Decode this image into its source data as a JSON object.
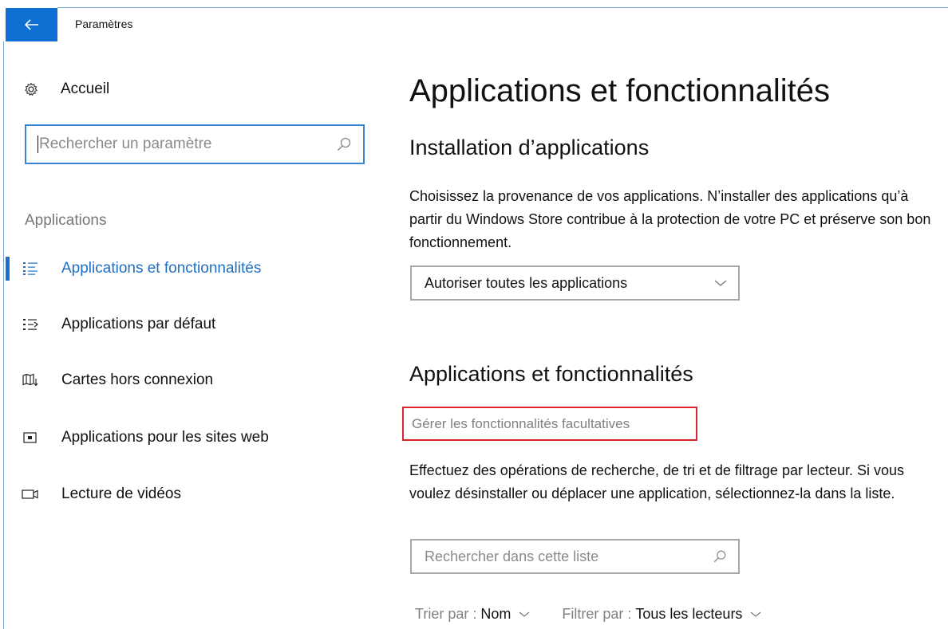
{
  "window": {
    "title": "Paramètres",
    "accent_color": "#0f6fd3"
  },
  "sidebar": {
    "home_label": "Accueil",
    "search_placeholder": "Rechercher un paramètre",
    "section_label": "Applications",
    "items": [
      {
        "label": "Applications et fonctionnalités",
        "icon": "apps-features-icon",
        "active": true
      },
      {
        "label": "Applications par défaut",
        "icon": "default-apps-icon",
        "active": false
      },
      {
        "label": "Cartes hors connexion",
        "icon": "offline-maps-icon",
        "active": false
      },
      {
        "label": "Applications pour les sites web",
        "icon": "apps-websites-icon",
        "active": false
      },
      {
        "label": "Lecture de vidéos",
        "icon": "video-playback-icon",
        "active": false
      }
    ]
  },
  "main": {
    "page_title": "Applications et fonctionnalités",
    "install_section": {
      "heading": "Installation d’applications",
      "description": "Choisissez la provenance de vos applications. N’installer des applications qu’à partir du Windows Store contribue à la protection de votre PC et préserve son bon fonctionnement.",
      "dropdown_value": "Autoriser toutes les applications"
    },
    "apps_section": {
      "heading": "Applications et fonctionnalités",
      "optional_features_link": "Gérer les fonctionnalités facultatives",
      "highlight_color": "#e0232a",
      "description": "Effectuez des opérations de recherche, de tri et de filtrage par lecteur. Si vous voulez désinstaller ou déplacer une application, sélectionnez-la dans la liste.",
      "list_search_placeholder": "Rechercher dans cette liste",
      "sort_label": "Trier par :",
      "sort_value": "Nom",
      "filter_label": "Filtrer par :",
      "filter_value": "Tous les lecteurs"
    }
  }
}
